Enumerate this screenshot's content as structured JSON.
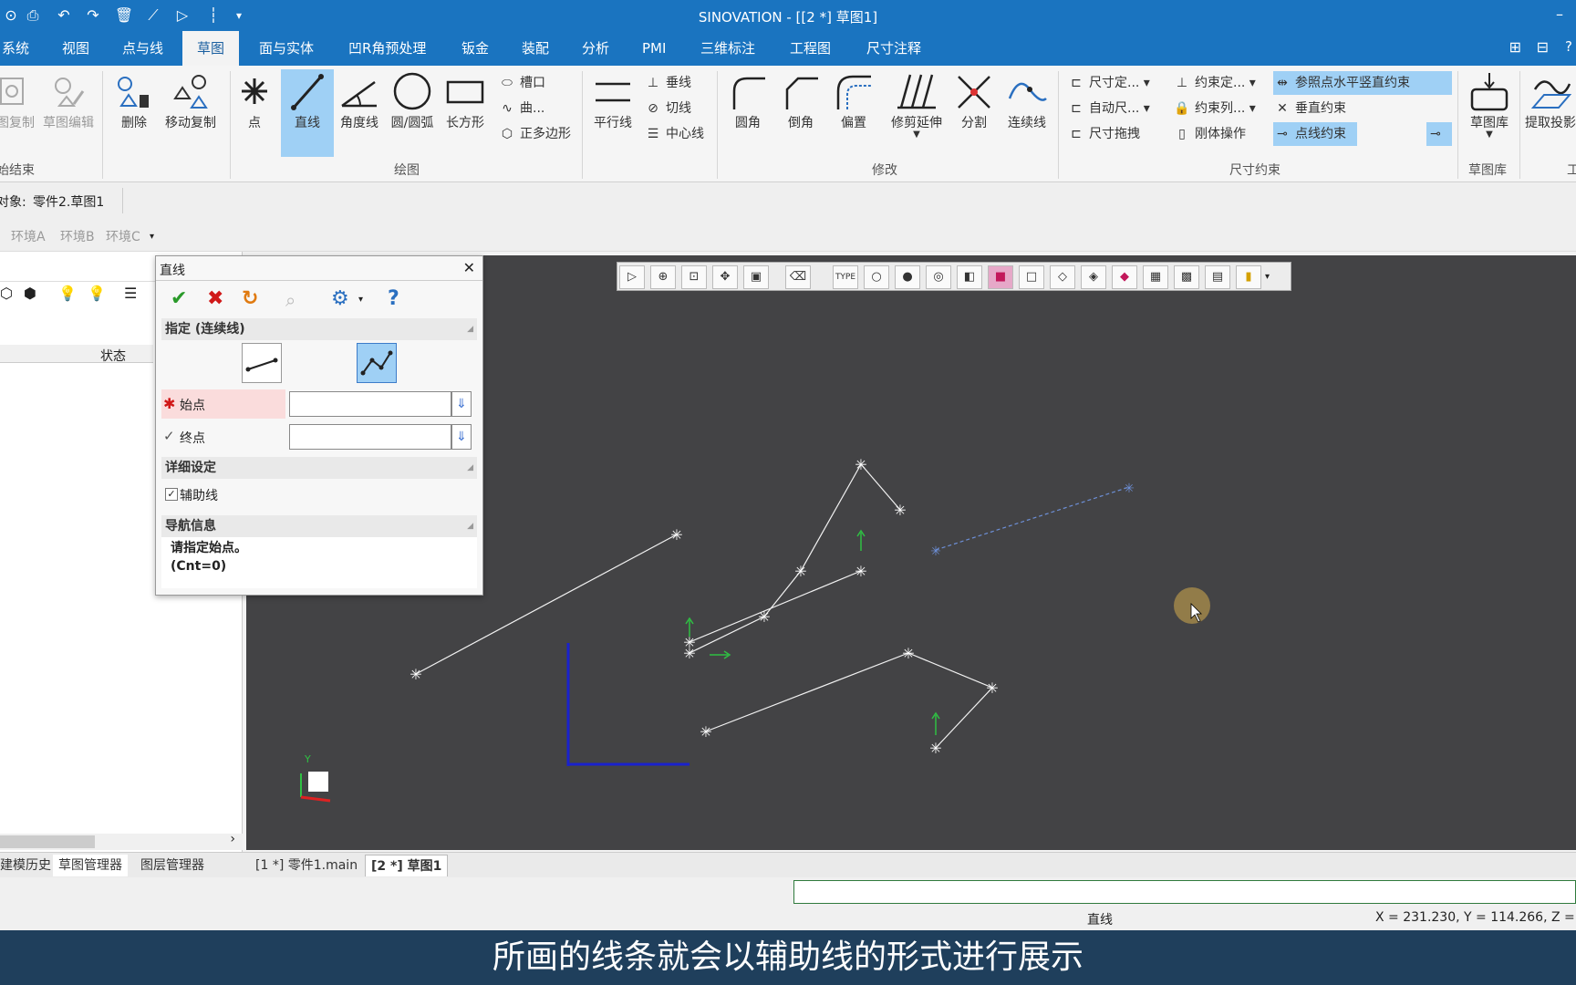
{
  "app": {
    "title": "SINOVATION - [[2 *] 草图1]"
  },
  "menu": [
    "系统",
    "视图",
    "点与线",
    "草图",
    "面与实体",
    "凹R角预处理",
    "钣金",
    "装配",
    "分析",
    "PMI",
    "三维标注",
    "工程图",
    "尺寸注释"
  ],
  "ribbon": {
    "btn_copy": "图复制",
    "btn_sketch_edit": "草图编辑",
    "btn_delete": "删除",
    "btn_move_copy": "移动复制",
    "btn_point": "点",
    "btn_line": "直线",
    "btn_angle_line": "角度线",
    "btn_circle": "圆/圆弧",
    "btn_rect": "长方形",
    "small_slot": "槽口",
    "small_curve": "曲...",
    "small_polygon": "正多边形",
    "btn_parallel": "平行线",
    "small_perp": "垂线",
    "small_tangent": "切线",
    "small_center": "中心线",
    "btn_fillet": "圆角",
    "btn_chamfer": "倒角",
    "btn_offset": "偏置",
    "btn_trim": "修剪延伸",
    "btn_split": "分割",
    "btn_connect": "连续线",
    "small_dim_def": "尺寸定...",
    "small_auto_dim": "自动尺...",
    "small_dim_drag": "尺寸拖拽",
    "small_con_def": "约束定...",
    "small_con_list": "约束列...",
    "small_rigid": "刚体操作",
    "small_ref_hv": "参照点水平竖直约束",
    "small_vert": "垂直约束",
    "small_ptline": "点线约束",
    "btn_library": "草图库",
    "btn_extract": "提取投影",
    "grp_end": "始结束",
    "grp_draw": "绘图",
    "grp_modify": "修改",
    "grp_dimcon": "尺寸约束",
    "grp_lib": "草图库",
    "grp_tool": "工"
  },
  "objbar": {
    "label": "对象:",
    "value": "零件2.草图1"
  },
  "env": [
    "环境A",
    "环境B",
    "环境C"
  ],
  "leftpanel": {
    "col_status": "状态"
  },
  "bottomtabs": {
    "left": [
      "建模历史",
      "草图管理器",
      "图层管理器"
    ],
    "docs": [
      "[1 *] 零件1.main",
      "[2 *] 草图1"
    ]
  },
  "dialog": {
    "title": "直线",
    "sec_specify": "指定 (连续线)",
    "start_label": "始点",
    "end_label": "终点",
    "sec_detail": "详细设定",
    "aux_label": "辅助线",
    "sec_nav": "导航信息",
    "nav_text1": "请指定始点。",
    "nav_text2": "(Cnt=0)"
  },
  "status": {
    "command": "直线",
    "coords": "X =  231.230, Y =  114.266, Z ="
  },
  "subtitle": "所画的线条就会以辅助线的形式进行展示",
  "colors": {
    "titlebar": "#1a74c0",
    "viewport": "#434345",
    "accent": "#9fd0f5",
    "subtitle_bg": "#1f3f5c"
  }
}
